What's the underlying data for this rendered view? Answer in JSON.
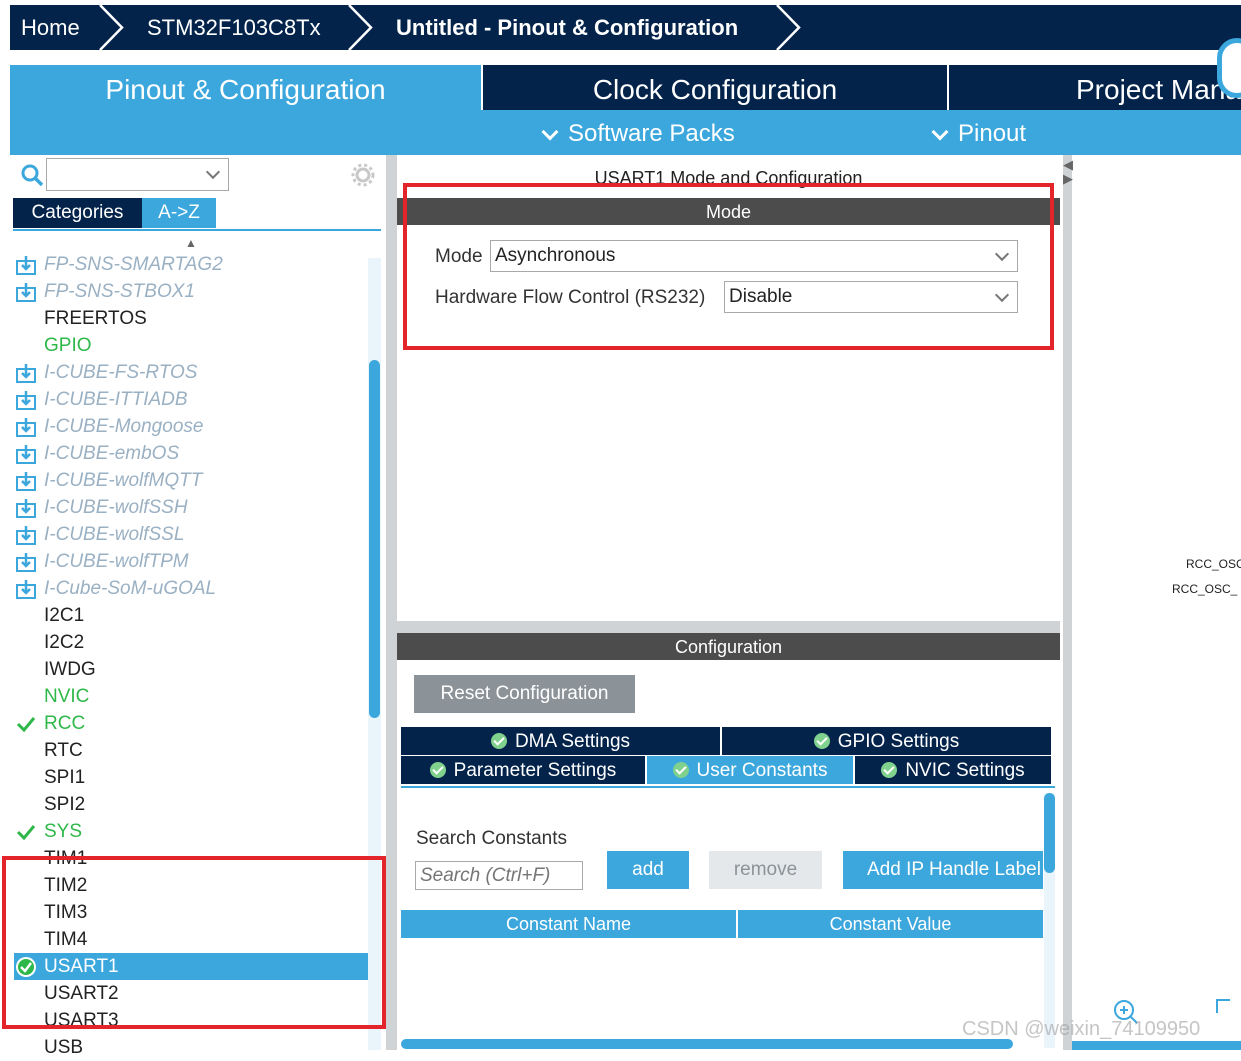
{
  "breadcrumb": {
    "home": "Home",
    "device": "STM32F103C8Tx",
    "project": "Untitled - Pinout & Configuration"
  },
  "tabs": {
    "pinout": "Pinout & Configuration",
    "clock": "Clock Configuration",
    "project": "Project Mana"
  },
  "subtabs": {
    "software_packs": "Software Packs",
    "pinout": "Pinout"
  },
  "sidebar": {
    "search_value": "",
    "categories_label": "Categories",
    "az_label": "A->Z",
    "items": [
      {
        "label": "FP-SNS-SMARTAG2",
        "kind": "pack"
      },
      {
        "label": "FP-SNS-STBOX1",
        "kind": "pack"
      },
      {
        "label": "FREERTOS",
        "kind": "normal"
      },
      {
        "label": "GPIO",
        "kind": "green"
      },
      {
        "label": "I-CUBE-FS-RTOS",
        "kind": "pack"
      },
      {
        "label": "I-CUBE-ITTIADB",
        "kind": "pack"
      },
      {
        "label": "I-CUBE-Mongoose",
        "kind": "pack"
      },
      {
        "label": "I-CUBE-embOS",
        "kind": "pack"
      },
      {
        "label": "I-CUBE-wolfMQTT",
        "kind": "pack"
      },
      {
        "label": "I-CUBE-wolfSSH",
        "kind": "pack"
      },
      {
        "label": "I-CUBE-wolfSSL",
        "kind": "pack"
      },
      {
        "label": "I-CUBE-wolfTPM",
        "kind": "pack"
      },
      {
        "label": "I-Cube-SoM-uGOAL",
        "kind": "pack"
      },
      {
        "label": "I2C1",
        "kind": "normal"
      },
      {
        "label": "I2C2",
        "kind": "normal"
      },
      {
        "label": "IWDG",
        "kind": "normal"
      },
      {
        "label": "NVIC",
        "kind": "green"
      },
      {
        "label": "RCC",
        "kind": "checked"
      },
      {
        "label": "RTC",
        "kind": "normal"
      },
      {
        "label": "SPI1",
        "kind": "normal"
      },
      {
        "label": "SPI2",
        "kind": "normal"
      },
      {
        "label": "SYS",
        "kind": "checked"
      },
      {
        "label": "TIM1",
        "kind": "normal"
      },
      {
        "label": "TIM2",
        "kind": "normal"
      },
      {
        "label": "TIM3",
        "kind": "normal"
      },
      {
        "label": "TIM4",
        "kind": "normal"
      },
      {
        "label": "USART1",
        "kind": "selected"
      },
      {
        "label": "USART2",
        "kind": "normal"
      },
      {
        "label": "USART3",
        "kind": "normal"
      },
      {
        "label": "USB",
        "kind": "normal"
      }
    ]
  },
  "panel": {
    "title": "USART1 Mode and Configuration",
    "mode_header": "Mode",
    "mode_label": "Mode",
    "mode_value": "Asynchronous",
    "flow_label": "Hardware Flow Control (RS232)",
    "flow_value": "Disable",
    "config_header": "Configuration",
    "reset_button": "Reset Configuration",
    "config_tabs": {
      "dma": "DMA Settings",
      "gpio": "GPIO Settings",
      "parameter": "Parameter Settings",
      "user_constants": "User Constants",
      "nvic": "NVIC Settings"
    },
    "search_constants_label": "Search Constants",
    "search_placeholder": "Search (Ctrl+F)",
    "add_button": "add",
    "remove_button": "remove",
    "add_ip_button": "Add IP Handle Label",
    "col_name": "Constant Name",
    "col_value": "Constant Value"
  },
  "pin_labels": {
    "osc_in": "RCC_OSC",
    "osc_out": "RCC_OSC_"
  },
  "watermark": "CSDN @weixin_74109950",
  "colors": {
    "navy": "#03234b",
    "accent_blue": "#3ca7dd",
    "section_gray": "#4c4c4c",
    "highlight_red": "#e3242b",
    "ok_green": "#2fb84a",
    "pack_gray": "#9ab0c3"
  }
}
